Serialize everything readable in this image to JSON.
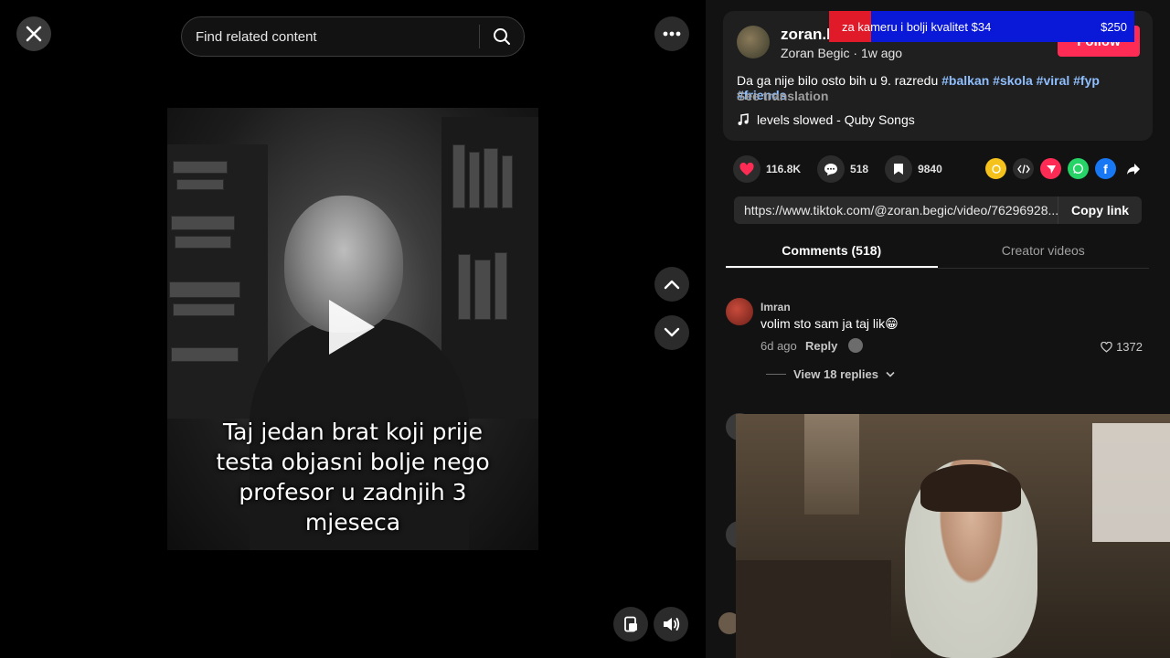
{
  "search": {
    "placeholder": "Find related content"
  },
  "video": {
    "caption_lines": [
      "Taj jedan brat koji prije",
      "testa objasni bolje nego",
      "profesor u zadnjih 3",
      "mjeseca"
    ]
  },
  "post": {
    "username": "zoran.b",
    "display_name": "Zoran Begic",
    "time_ago": "1w ago",
    "follow_label": "Follow",
    "description": "Da ga nije bilo osto bih u 9. razredu",
    "hashtags": [
      "#balkan",
      "#skola",
      "#viral",
      "#fyp",
      "#friends"
    ],
    "see_translation": "See translation",
    "music": "levels slowed - Quby Songs"
  },
  "stats": {
    "likes": "116.8K",
    "comments": "518",
    "saves": "9840"
  },
  "share": {
    "icons": [
      "coin-icon",
      "embed-icon",
      "send-icon",
      "whatsapp-icon",
      "facebook-icon",
      "share-arrow-icon"
    ]
  },
  "link": {
    "url": "https://www.tiktok.com/@zoran.begic/video/76296928...",
    "copy_label": "Copy link"
  },
  "tabs": [
    {
      "label": "Comments (518)"
    },
    {
      "label": "Creator videos"
    }
  ],
  "comments": [
    {
      "author": "Imran",
      "text": "volim sto sam ja taj lik😁",
      "time": "6d ago",
      "reply_label": "Reply",
      "likes": "1372",
      "view_replies": "View 18 replies"
    }
  ],
  "donation": {
    "message": "za kameru i bolji kvalitet $34",
    "amount": "$250"
  },
  "colors": {
    "accent": "#fe2c55",
    "hashtag": "#8fbfff",
    "panel_bg": "#121212",
    "card_bg": "#1f1f1f",
    "donation_blue": "#0a18d8",
    "donation_red": "#e11a2a"
  }
}
